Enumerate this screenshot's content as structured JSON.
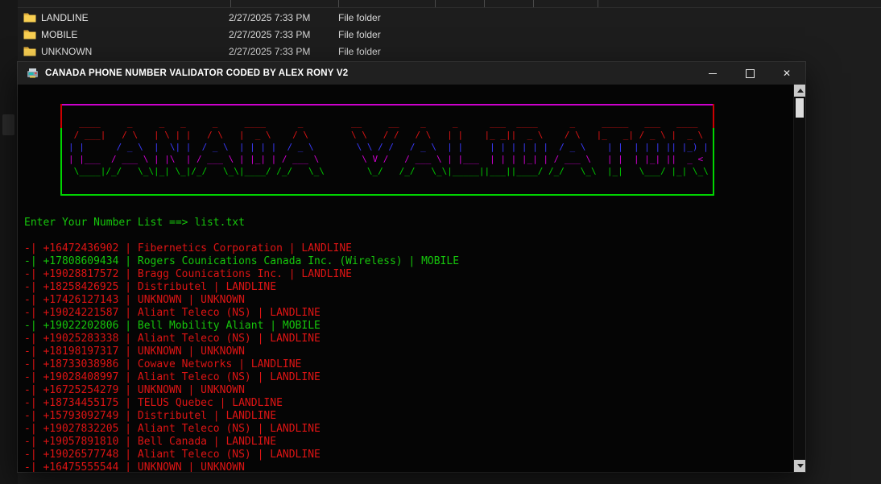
{
  "theme": {
    "term_red": "#de1414",
    "term_green": "#16c60c",
    "art_blue": "#3b3bff",
    "art_magenta": "#d400d4",
    "art_green": "#00cc00",
    "border_red": "#cc0000",
    "border_green": "#00d400",
    "border_magenta": "#cc00cc",
    "folder_yellow": "#f8cf52",
    "folder_yellow_dark": "#e0ae3c"
  },
  "explorer": {
    "rows": [
      {
        "name": "LANDLINE",
        "date_modified": "2/27/2025 7:33 PM",
        "type": "File folder"
      },
      {
        "name": "MOBILE",
        "date_modified": "2/27/2025 7:33 PM",
        "type": "File folder"
      },
      {
        "name": "UNKNOWN",
        "date_modified": "2/27/2025 7:33 PM",
        "type": "File folder"
      }
    ]
  },
  "window": {
    "title": "CANADA PHONE NUMBER VALIDATOR CODED BY ALEX RONY V2",
    "controls": [
      {
        "name": "minimize"
      },
      {
        "name": "maximize"
      },
      {
        "name": "close",
        "glyph": "✕"
      }
    ]
  },
  "banner": {
    "text": "CANADA VALIDATOR",
    "words": [
      "CANADA",
      "VALIDATOR"
    ],
    "word_gap": "     ",
    "row_colors": [
      "red",
      "red",
      "blue",
      "magenta",
      "green"
    ],
    "font": {
      "C": [
        "  ____ ",
        " / ___|",
        "| |    ",
        "| |___ ",
        " \\____|"
      ],
      "A": [
        "    _    ",
        "   / \\   ",
        "  / _ \\  ",
        " / ___ \\ ",
        "/_/   \\_\\"
      ],
      "N": [
        " _   _ ",
        "| \\ | |",
        "|  \\| |",
        "| |\\  |",
        "|_| \\_|"
      ],
      "D": [
        " ____  ",
        "|  _ \\ ",
        "| | | |",
        "| |_| |",
        "|____/ "
      ],
      "V": [
        "__     __",
        "\\ \\   / /",
        " \\ \\ / / ",
        "  \\ V /  ",
        "   \\_/   "
      ],
      "L": [
        " _     ",
        "| |    ",
        "| |    ",
        "| |___ ",
        "|_____|"
      ],
      "I": [
        " ___ ",
        "|_ _|",
        " | | ",
        " | | ",
        "|___|"
      ],
      "T": [
        " _____ ",
        "|_   _|",
        "  | |  ",
        "  | |  ",
        "  |_|  "
      ],
      "O": [
        "  ___  ",
        " / _ \\ ",
        "| | | |",
        "| |_| |",
        " \\___/ "
      ],
      "R": [
        " ____  ",
        "|  _ \\ ",
        "| |_) |",
        "|  _ < ",
        "|_| \\_\\"
      ]
    }
  },
  "console": {
    "prompt": "Enter Your Number List ==> list.txt",
    "results": [
      {
        "text": "-| +16472436902 | Fibernetics Corporation | LANDLINE",
        "color": "red"
      },
      {
        "text": "-| +17808609434 | Rogers Counications Canada Inc. (Wireless) | MOBILE",
        "color": "green"
      },
      {
        "text": "-| +19028817572 | Bragg Counications Inc. | LANDLINE",
        "color": "red"
      },
      {
        "text": "-| +18258426925 | Distributel | LANDLINE",
        "color": "red"
      },
      {
        "text": "-| +17426127143 | UNKNOWN | UNKNOWN",
        "color": "red"
      },
      {
        "text": "-| +19024221587 | Aliant Teleco (NS) | LANDLINE",
        "color": "red"
      },
      {
        "text": "-| +19022202806 | Bell Mobility Aliant | MOBILE",
        "color": "green"
      },
      {
        "text": "-| +19025283338 | Aliant Teleco (NS) | LANDLINE",
        "color": "red"
      },
      {
        "text": "-| +18198197317 | UNKNOWN | UNKNOWN",
        "color": "red"
      },
      {
        "text": "-| +18733038986 | Cowave Networks | LANDLINE",
        "color": "red"
      },
      {
        "text": "-| +19028408997 | Aliant Teleco (NS) | LANDLINE",
        "color": "red"
      },
      {
        "text": "-| +16725254279 | UNKNOWN | UNKNOWN",
        "color": "red"
      },
      {
        "text": "-| +18734455175 | TELUS Quebec | LANDLINE",
        "color": "red"
      },
      {
        "text": "-| +15793092749 | Distributel | LANDLINE",
        "color": "red"
      },
      {
        "text": "-| +19027832205 | Aliant Teleco (NS) | LANDLINE",
        "color": "red"
      },
      {
        "text": "-| +19057891810 | Bell Canada | LANDLINE",
        "color": "red"
      },
      {
        "text": "-| +19026577748 | Aliant Teleco (NS) | LANDLINE",
        "color": "red"
      },
      {
        "text": "-| +16475555544 | UNKNOWN | UNKNOWN",
        "color": "red"
      }
    ]
  }
}
